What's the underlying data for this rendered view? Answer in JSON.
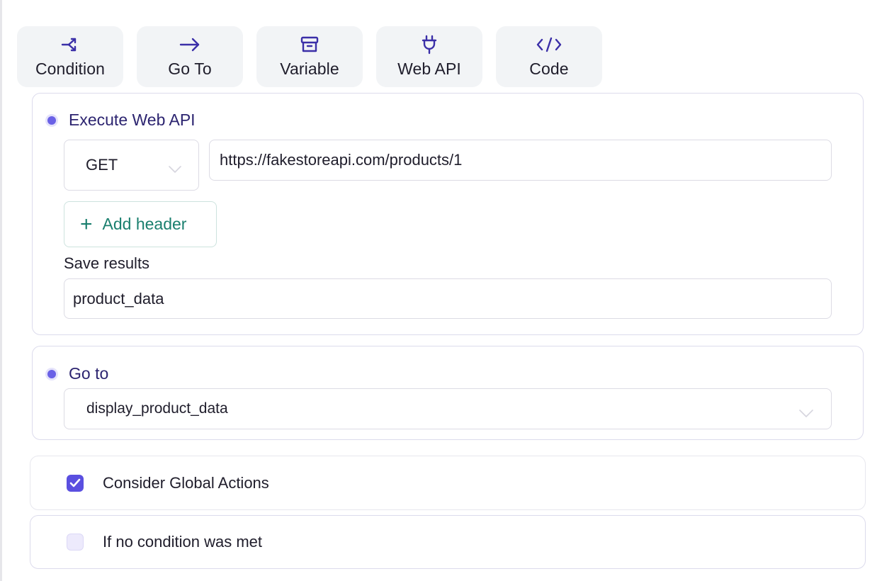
{
  "toolbar": {
    "items": [
      {
        "label": "Condition",
        "icon": "branch-icon"
      },
      {
        "label": "Go To",
        "icon": "arrow-right-icon"
      },
      {
        "label": "Variable",
        "icon": "archive-box-icon"
      },
      {
        "label": "Web API",
        "icon": "plug-icon"
      },
      {
        "label": "Code",
        "icon": "code-brackets-icon"
      }
    ]
  },
  "web_api_step": {
    "title": "Execute Web API",
    "method": "GET",
    "url": "https://fakestoreapi.com/products/1",
    "add_header_label": "Add header",
    "save_results_label": "Save results",
    "save_results_value": "product_data"
  },
  "goto_step": {
    "title": "Go to",
    "target": "display_product_data"
  },
  "options": {
    "global_actions": {
      "label": "Consider Global Actions",
      "checked": true
    },
    "no_condition": {
      "label": "If no condition was met",
      "checked": false
    }
  },
  "colors": {
    "accent": "#5a4fe0",
    "title_text": "#2c2470",
    "add_header_text": "#1a7f6e",
    "tool_bg": "#f2f4f6"
  }
}
